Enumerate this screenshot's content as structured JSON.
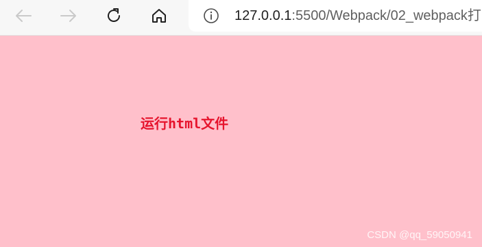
{
  "browser": {
    "url_host": "127.0.0.1",
    "url_rest": ":5500/Webpack/02_webpack打"
  },
  "page": {
    "background": "#ffc0cb",
    "text": "运行html文件",
    "text_color": "#e6142d"
  },
  "watermark": "CSDN @qq_59050941",
  "icons": {
    "back": "back-arrow-icon",
    "forward": "forward-arrow-icon",
    "refresh": "refresh-icon",
    "home": "home-icon",
    "info": "info-icon"
  }
}
